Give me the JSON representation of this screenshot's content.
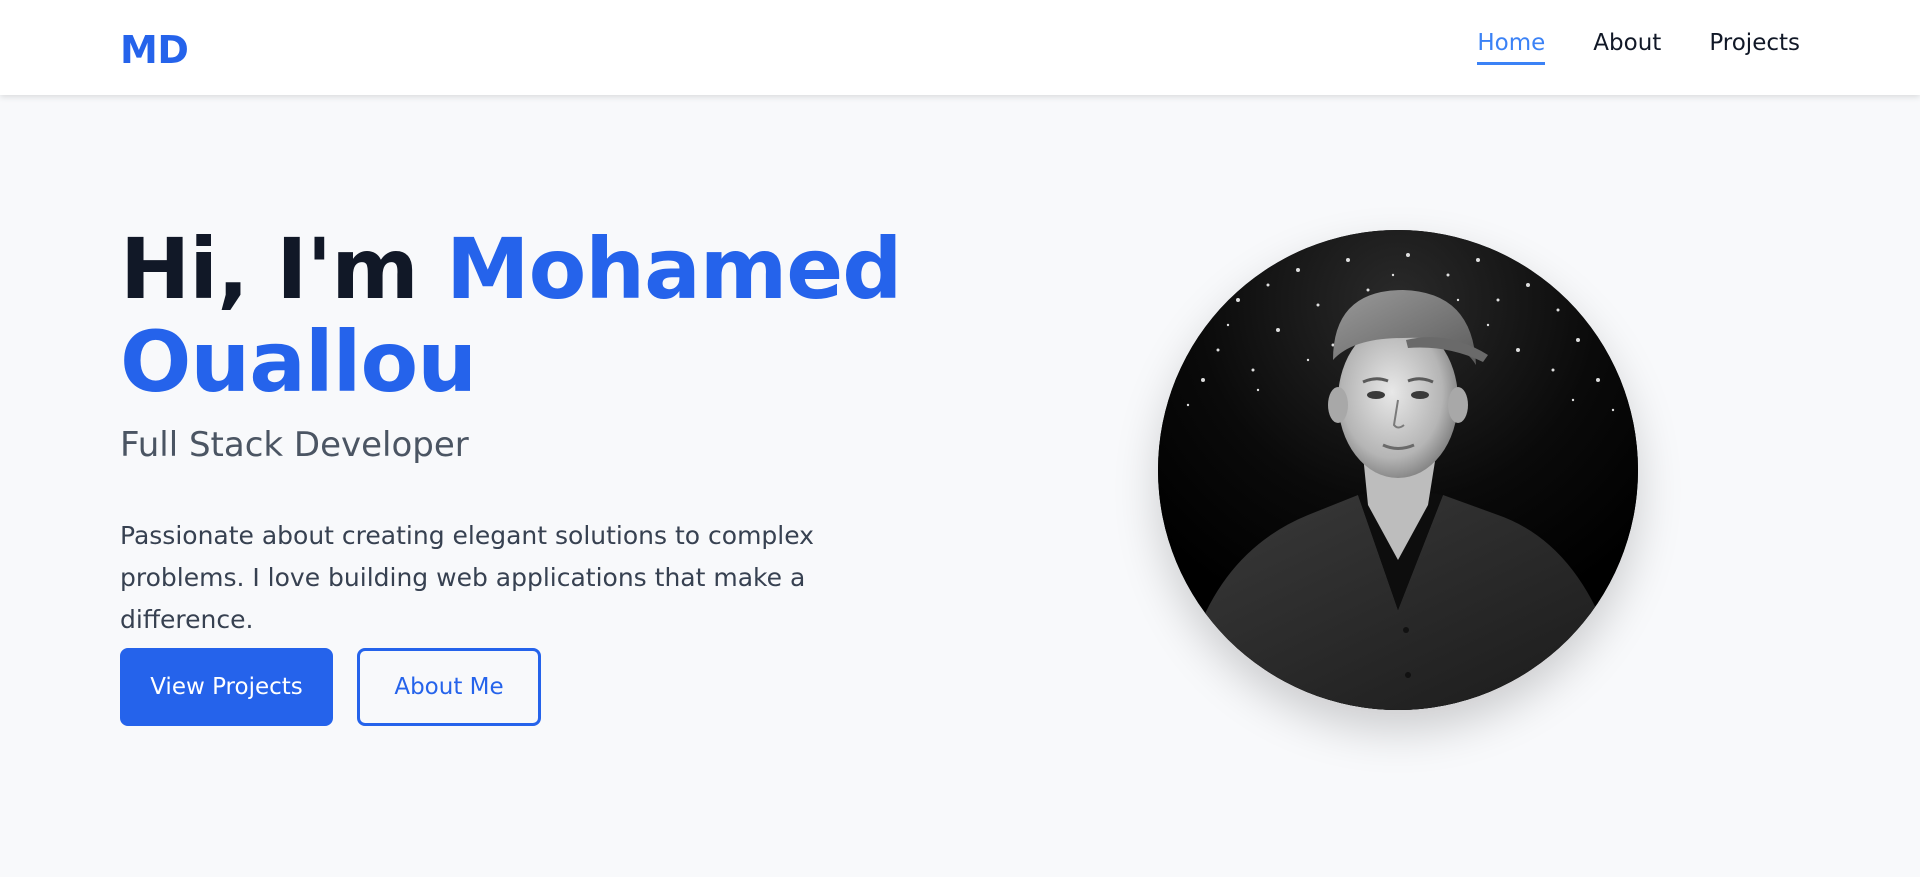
{
  "nav": {
    "logo": "MD",
    "links": [
      {
        "label": "Home",
        "active": true
      },
      {
        "label": "About",
        "active": false
      },
      {
        "label": "Projects",
        "active": false
      }
    ]
  },
  "hero": {
    "greeting": "Hi, I'm ",
    "first_name": "Mohamed",
    "last_name": "Ouallou",
    "subtitle": "Full Stack Developer",
    "description": "Passionate about creating elegant solutions to complex problems. I love building web applications that make a difference.",
    "primary_button": "View Projects",
    "secondary_button": "About Me"
  },
  "avatar": {
    "description_icon": "profile-photo"
  },
  "colors": {
    "accent": "#2563eb",
    "nav_active": "#3b82f6",
    "heading": "#111827",
    "subtitle": "#4b5563",
    "body_text": "#374151",
    "background": "#f8f9fb"
  }
}
